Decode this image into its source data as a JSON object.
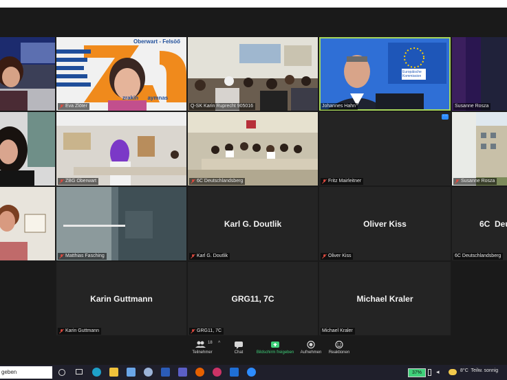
{
  "tiles": {
    "t1_name": "",
    "t2_name": "Eva Zlöter",
    "t3_name": "Q-SK Karin Ruprecht 905016",
    "t4_name": "Johannes Hahn",
    "t5_name": "Susanne Rosza",
    "t6_name": "",
    "t7_name": "ZBG Oberwart",
    "t8_name": "6C Deutschlandsberg",
    "t9_name": "Fritz Mairleitner",
    "t10_name": "Susanne Rosza",
    "t11_name": "",
    "t12_name": "Matthias Fasching",
    "t13_name": "Karl G. Doutlik",
    "t13_center": "Karl G. Doutlik",
    "t14_name": "Oliver Kiss",
    "t14_center": "Oliver Kiss",
    "t15_name": "6C Deutschlandsberg",
    "t15_center": "6C  Deu",
    "t16_name": "Karin Guttmann",
    "t16_center": "Karin Guttmann",
    "t17_name": "GRG11, 7C",
    "t17_center": "GRG11, 7C",
    "t18_name": "Michael Kraler",
    "t18_center": "Michael Kraler",
    "zbg_banner_text": "Oberwart - Felsöő",
    "zbg_banner_sub": "zrakin      aymnas",
    "eu_flag_text": "Europäische Kommission"
  },
  "toolbar": {
    "participants_label": "Teilnehmer",
    "participants_count": "18",
    "chat_label": "Chat",
    "share_label": "Bildschirm freigeben",
    "record_label": "Aufnehmen",
    "reactions_label": "Reaktionen"
  },
  "taskbar": {
    "search_text": "geben",
    "battery": "37%",
    "weather": "8°C  Teilw. sonnig"
  },
  "colors": {
    "active_border": "#a6d65a",
    "share_green": "#3fd07a",
    "tile_bg": "#242424",
    "app_bg": "#1a1a1a"
  }
}
